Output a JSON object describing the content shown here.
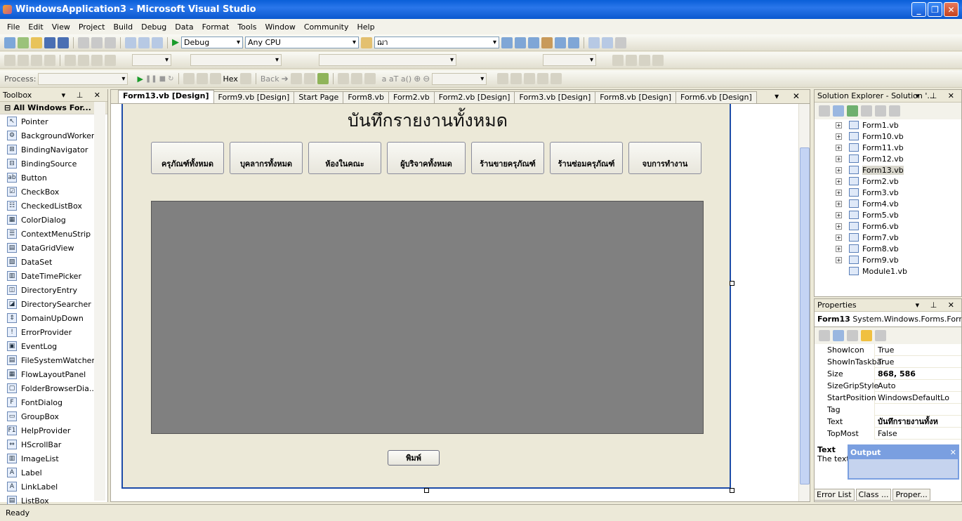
{
  "window": {
    "title": "WindowsApplication3 - Microsoft Visual Studio"
  },
  "menu": [
    "File",
    "Edit",
    "View",
    "Project",
    "Build",
    "Debug",
    "Data",
    "Format",
    "Tools",
    "Window",
    "Community",
    "Help"
  ],
  "toolbar": {
    "config": "Debug",
    "platform": "Any CPU",
    "find": "ฌา",
    "process_label": "Process:",
    "hex": "Hex",
    "back": "Back"
  },
  "toolbox": {
    "title": "Toolbox",
    "group": "All Windows For...",
    "items": [
      "Pointer",
      "BackgroundWorker",
      "BindingNavigator",
      "BindingSource",
      "Button",
      "CheckBox",
      "CheckedListBox",
      "ColorDialog",
      "ContextMenuStrip",
      "DataGridView",
      "DataSet",
      "DateTimePicker",
      "DirectoryEntry",
      "DirectorySearcher",
      "DomainUpDown",
      "ErrorProvider",
      "EventLog",
      "FileSystemWatcher",
      "FlowLayoutPanel",
      "FolderBrowserDia...",
      "FontDialog",
      "GroupBox",
      "HelpProvider",
      "HScrollBar",
      "ImageList",
      "Label",
      "LinkLabel",
      "ListBox"
    ]
  },
  "tabs": [
    "Form13.vb [Design]",
    "Form9.vb [Design]",
    "Start Page",
    "Form8.vb",
    "Form2.vb",
    "Form2.vb [Design]",
    "Form3.vb [Design]",
    "Form8.vb [Design]",
    "Form6.vb [Design]"
  ],
  "form": {
    "title": "บันทึกรายงานทั้งหมด",
    "buttons": [
      "ครุภัณฑ์ทั้งหมด",
      "บุคลากรทั้งหมด",
      "ห้องในคณะ",
      "ผู้บริจาคทั้งหมด",
      "ร้านขายครุภัณฑ์",
      "ร้านซ่อมครุภัณฑ์",
      "จบการทำงาน"
    ],
    "print": "พิมพ์"
  },
  "solution_explorer": {
    "title": "Solution Explorer - Solution '...",
    "items": [
      "Form1.vb",
      "Form10.vb",
      "Form11.vb",
      "Form12.vb",
      "Form13.vb",
      "Form2.vb",
      "Form3.vb",
      "Form4.vb",
      "Form5.vb",
      "Form6.vb",
      "Form7.vb",
      "Form8.vb",
      "Form9.vb",
      "Module1.vb"
    ]
  },
  "properties": {
    "title": "Properties",
    "object": "Form13",
    "type": "System.Windows.Forms.Forr",
    "rows": [
      {
        "name": "ShowIcon",
        "value": "True"
      },
      {
        "name": "ShowInTaskbar",
        "value": "True"
      },
      {
        "name": "Size",
        "value": "868, 586"
      },
      {
        "name": "SizeGripStyle",
        "value": "Auto"
      },
      {
        "name": "StartPosition",
        "value": "WindowsDefaultLo"
      },
      {
        "name": "Tag",
        "value": ""
      },
      {
        "name": "Text",
        "value": "บันทึกรายงานทั้งห"
      },
      {
        "name": "TopMost",
        "value": "False"
      }
    ],
    "desc_title": "Text",
    "desc_text": "The text"
  },
  "output": {
    "title": "Output"
  },
  "bottom_tabs": [
    "Error List",
    "Class ...",
    "Proper..."
  ],
  "status": "Ready"
}
